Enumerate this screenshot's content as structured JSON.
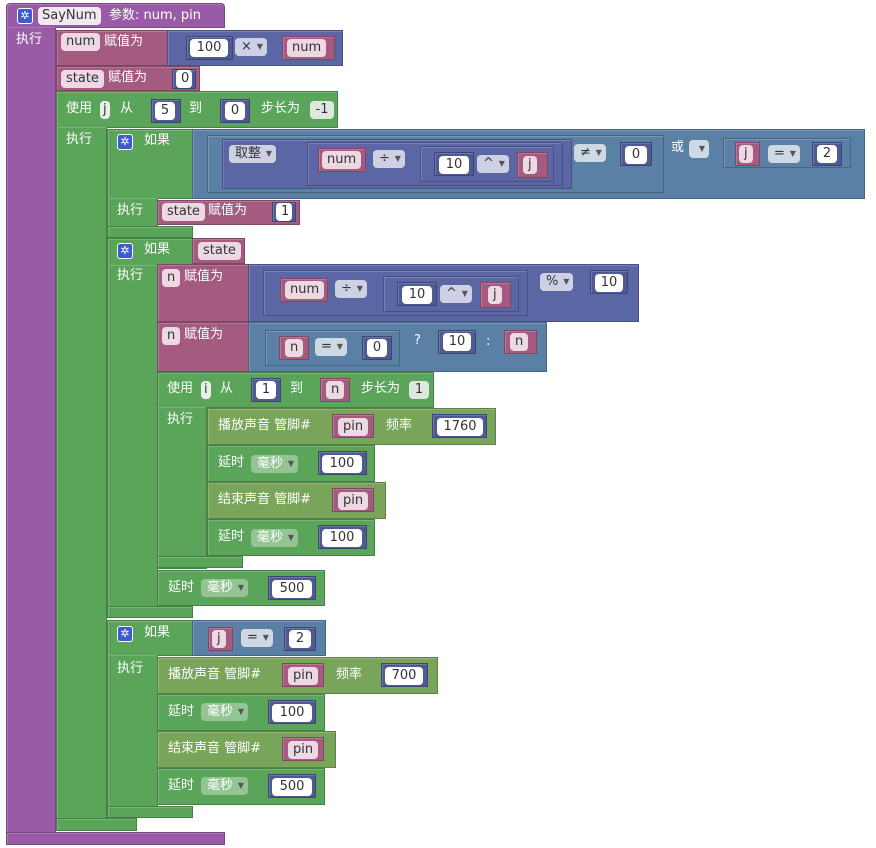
{
  "proc": {
    "name": "SayNum",
    "params_label": "参数: ",
    "params": "num, pin",
    "exec": "执行"
  },
  "v": {
    "num": "num",
    "state": "state",
    "j": "j",
    "n": "n",
    "pin": "pin",
    "k": "j"
  },
  "labels": {
    "assign": "赋值为",
    "use": "使用",
    "from": "从",
    "to": "到",
    "step": "步长为",
    "exec": "执行",
    "if": "如果",
    "or": "或",
    "round": "取整",
    "play": "播放声音 管脚#",
    "freq": "频率",
    "delay": "延时",
    "ms": "毫秒",
    "end": "结束声音 管脚#",
    "q": "?",
    "colon": ":"
  },
  "ops": {
    "mul": "×",
    "div": "÷",
    "pow": "^",
    "ne": "≠",
    "eq": "=",
    "mod": "%"
  },
  "nums": {
    "n100": "100",
    "n0": "0",
    "n5": "5",
    "neg1": "-1",
    "n10": "10",
    "n2": "2",
    "n1": "1",
    "n1760": "1760",
    "n500": "500",
    "n700": "700"
  }
}
